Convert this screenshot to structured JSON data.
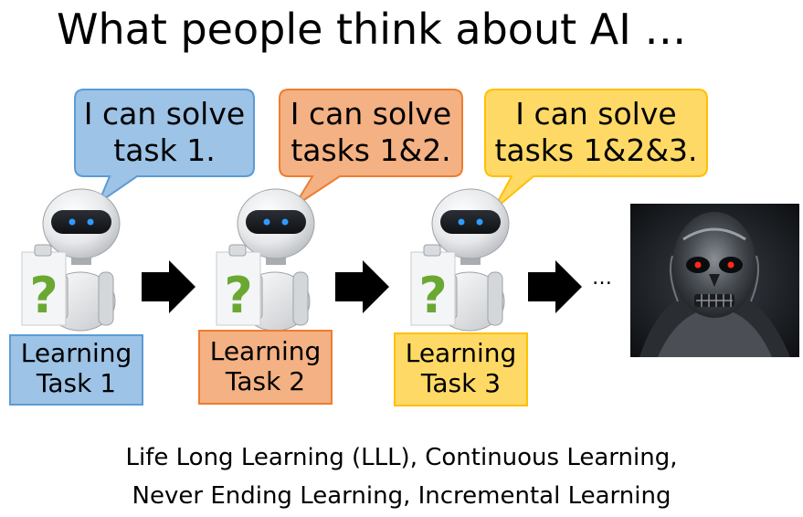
{
  "title": "What people think about AI …",
  "bubbles": [
    {
      "line1": "I can solve",
      "line2": "task 1.",
      "fill": "#9dc3e6",
      "stroke": "#5b9bd5"
    },
    {
      "line1": "I can solve",
      "line2": "tasks 1&2.",
      "fill": "#f4b183",
      "stroke": "#ed7d31"
    },
    {
      "line1": "I can solve",
      "line2": "tasks 1&2&3.",
      "fill": "#ffd966",
      "stroke": "#ffc000"
    }
  ],
  "tasks": [
    {
      "line1": "Learning",
      "line2": "Task 1",
      "fill": "#9dc3e6",
      "stroke": "#5b9bd5"
    },
    {
      "line1": "Learning",
      "line2": "Task 2",
      "fill": "#f4b183",
      "stroke": "#ed7d31"
    },
    {
      "line1": "Learning",
      "line2": "Task 3",
      "fill": "#ffd966",
      "stroke": "#ffc000"
    }
  ],
  "ellipsis": "…",
  "caption": {
    "line1": "Life Long Learning (LLL), Continuous Learning,",
    "line2": "Never Ending Learning, Incremental Learning"
  },
  "colors": {
    "arrow": "#000000",
    "question_mark": "#6aa832",
    "robot_eye": "#2f9bff"
  }
}
